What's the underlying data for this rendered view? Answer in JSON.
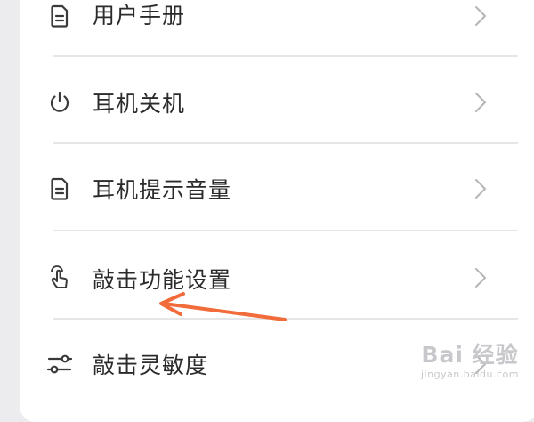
{
  "menu": {
    "items": [
      {
        "label": "用户手册",
        "icon": "document-icon"
      },
      {
        "label": "耳机关机",
        "icon": "power-icon"
      },
      {
        "label": "耳机提示音量",
        "icon": "document-icon"
      },
      {
        "label": "敲击功能设置",
        "icon": "tap-gesture-icon"
      },
      {
        "label": "敲击灵敏度",
        "icon": "sliders-icon"
      }
    ],
    "chevron_icon": "chevron-right-icon"
  },
  "annotation": {
    "arrow_color": "#f26b3a"
  },
  "watermark": {
    "logo_text": "Bai 经验",
    "subtext": "jingyan.baidu.com"
  },
  "colors": {
    "background": "#ececee",
    "card": "#ffffff",
    "text": "#2b2b2b",
    "icon": "#3a3a3a",
    "chevron": "#b5b5b8",
    "divider": "#e6e6e8"
  }
}
